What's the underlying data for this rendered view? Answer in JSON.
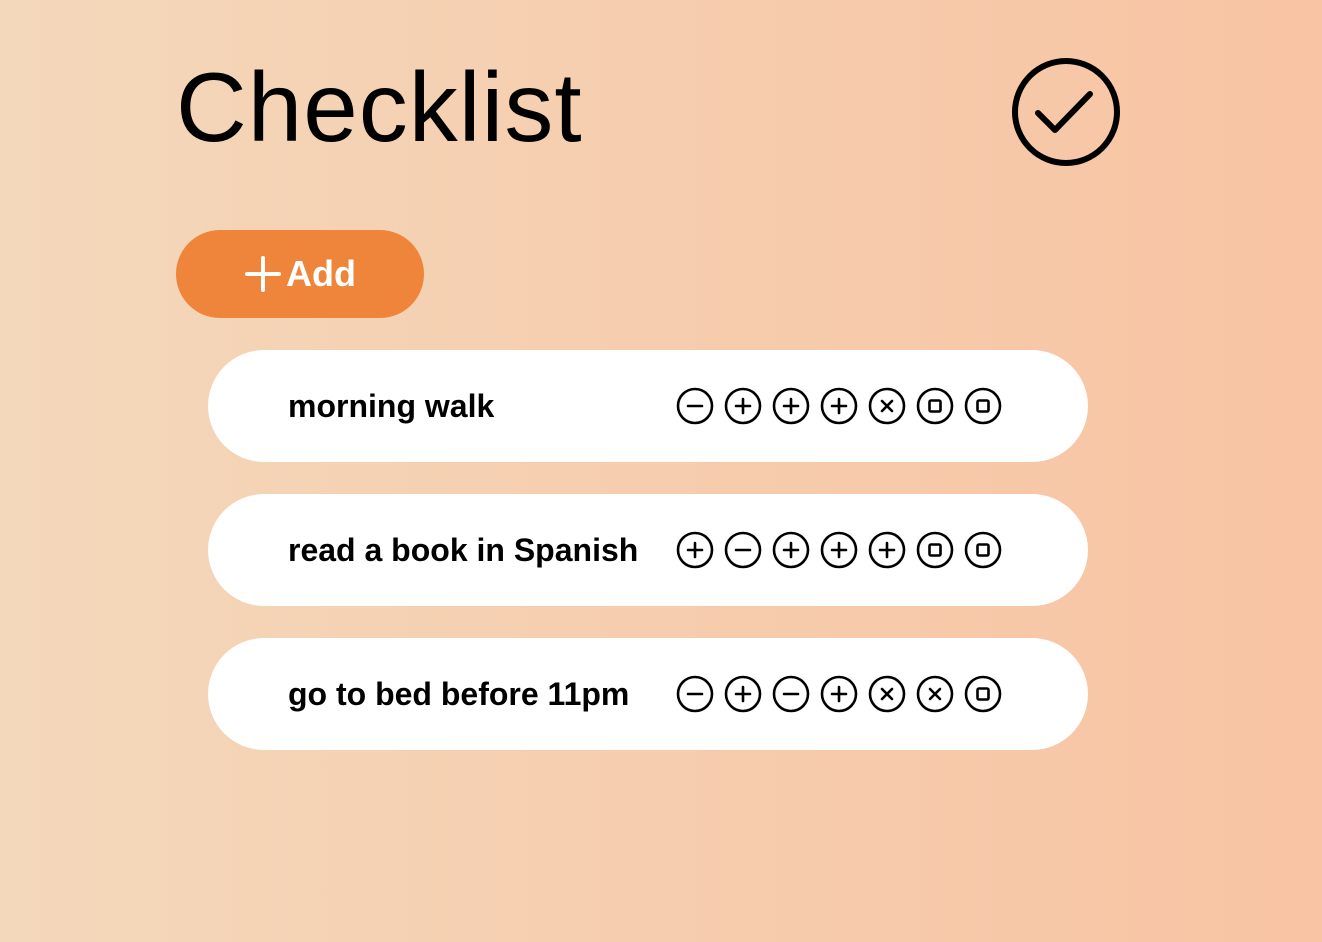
{
  "header": {
    "title": "Checklist"
  },
  "add_button": {
    "label": "Add"
  },
  "items": [
    {
      "label": "morning walk",
      "icons": [
        "minus",
        "plus",
        "plus",
        "plus",
        "times",
        "square",
        "square"
      ]
    },
    {
      "label": "read a book in Spanish",
      "icons": [
        "plus",
        "minus",
        "plus",
        "plus",
        "plus",
        "square",
        "square"
      ]
    },
    {
      "label": "go to bed before 11pm",
      "icons": [
        "minus",
        "plus",
        "minus",
        "plus",
        "times",
        "times",
        "square"
      ]
    }
  ],
  "colors": {
    "accent": "#ee853a",
    "row_background": "#ffffff",
    "background_start": "#f4d8bb",
    "background_end": "#f8c4a3"
  }
}
